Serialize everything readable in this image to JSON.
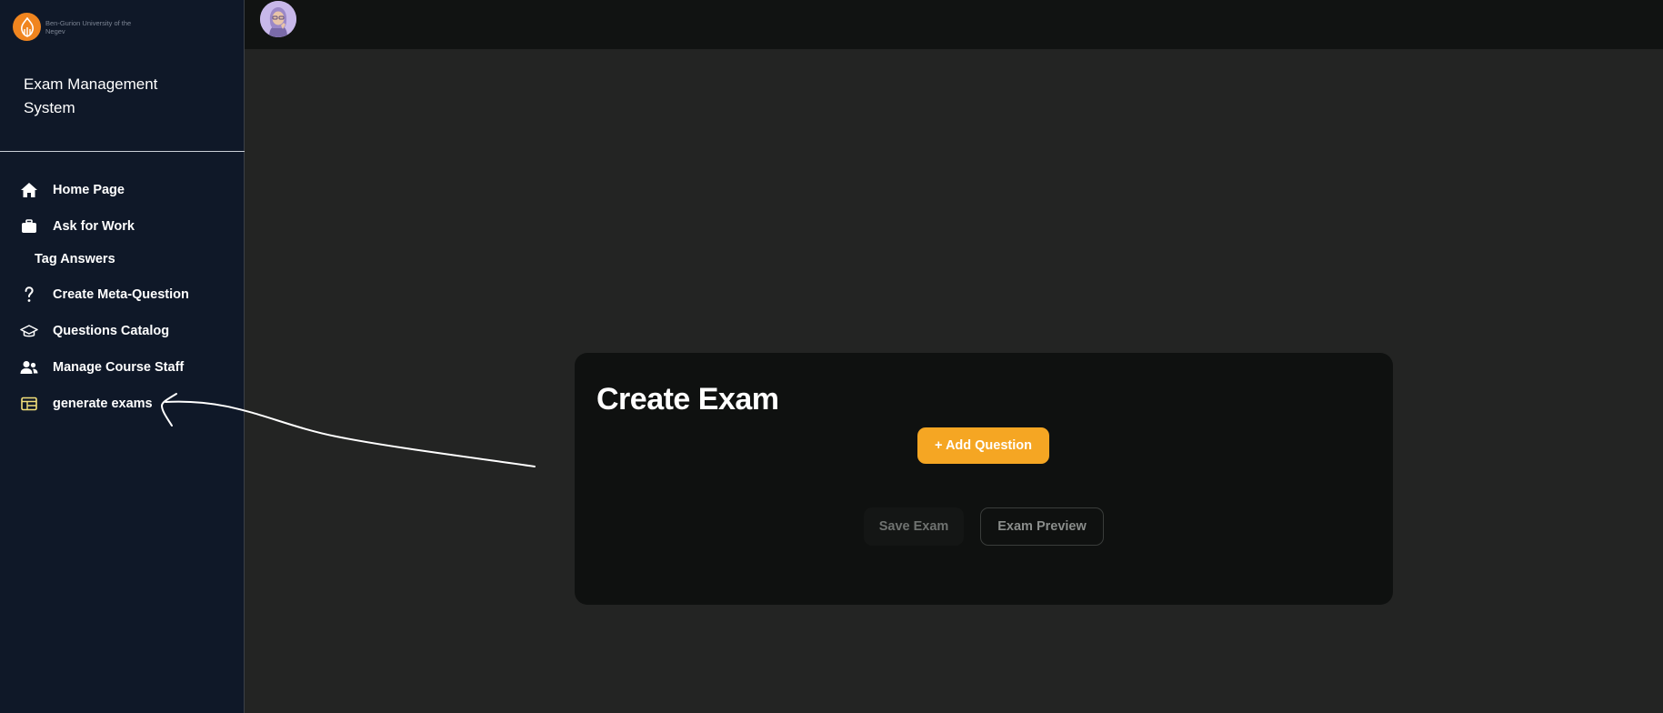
{
  "sidebar": {
    "logo_text": "Ben-Gurion University of the Negev",
    "app_title": "Exam Management System",
    "items": [
      {
        "label": "Home Page",
        "icon": "home-icon"
      },
      {
        "label": "Ask for Work",
        "icon": "briefcase-icon"
      },
      {
        "label": "Tag Answers",
        "icon": ""
      },
      {
        "label": "Create Meta-Question",
        "icon": "question-mark-icon"
      },
      {
        "label": "Questions Catalog",
        "icon": "graduation-cap-icon"
      },
      {
        "label": "Manage Course Staff",
        "icon": "users-icon"
      },
      {
        "label": "generate exams",
        "icon": "table-icon"
      }
    ]
  },
  "topbar": {
    "avatar": "user-avatar"
  },
  "main": {
    "card_title": "Create Exam",
    "add_question_label": "+ Add Question",
    "save_exam_label": "Save Exam",
    "exam_preview_label": "Exam Preview"
  },
  "colors": {
    "sidebar_bg": "#0f1828",
    "page_bg": "#232423",
    "card_bg": "#0f1110",
    "accent": "#f5a623",
    "logo": "#f0851f"
  }
}
